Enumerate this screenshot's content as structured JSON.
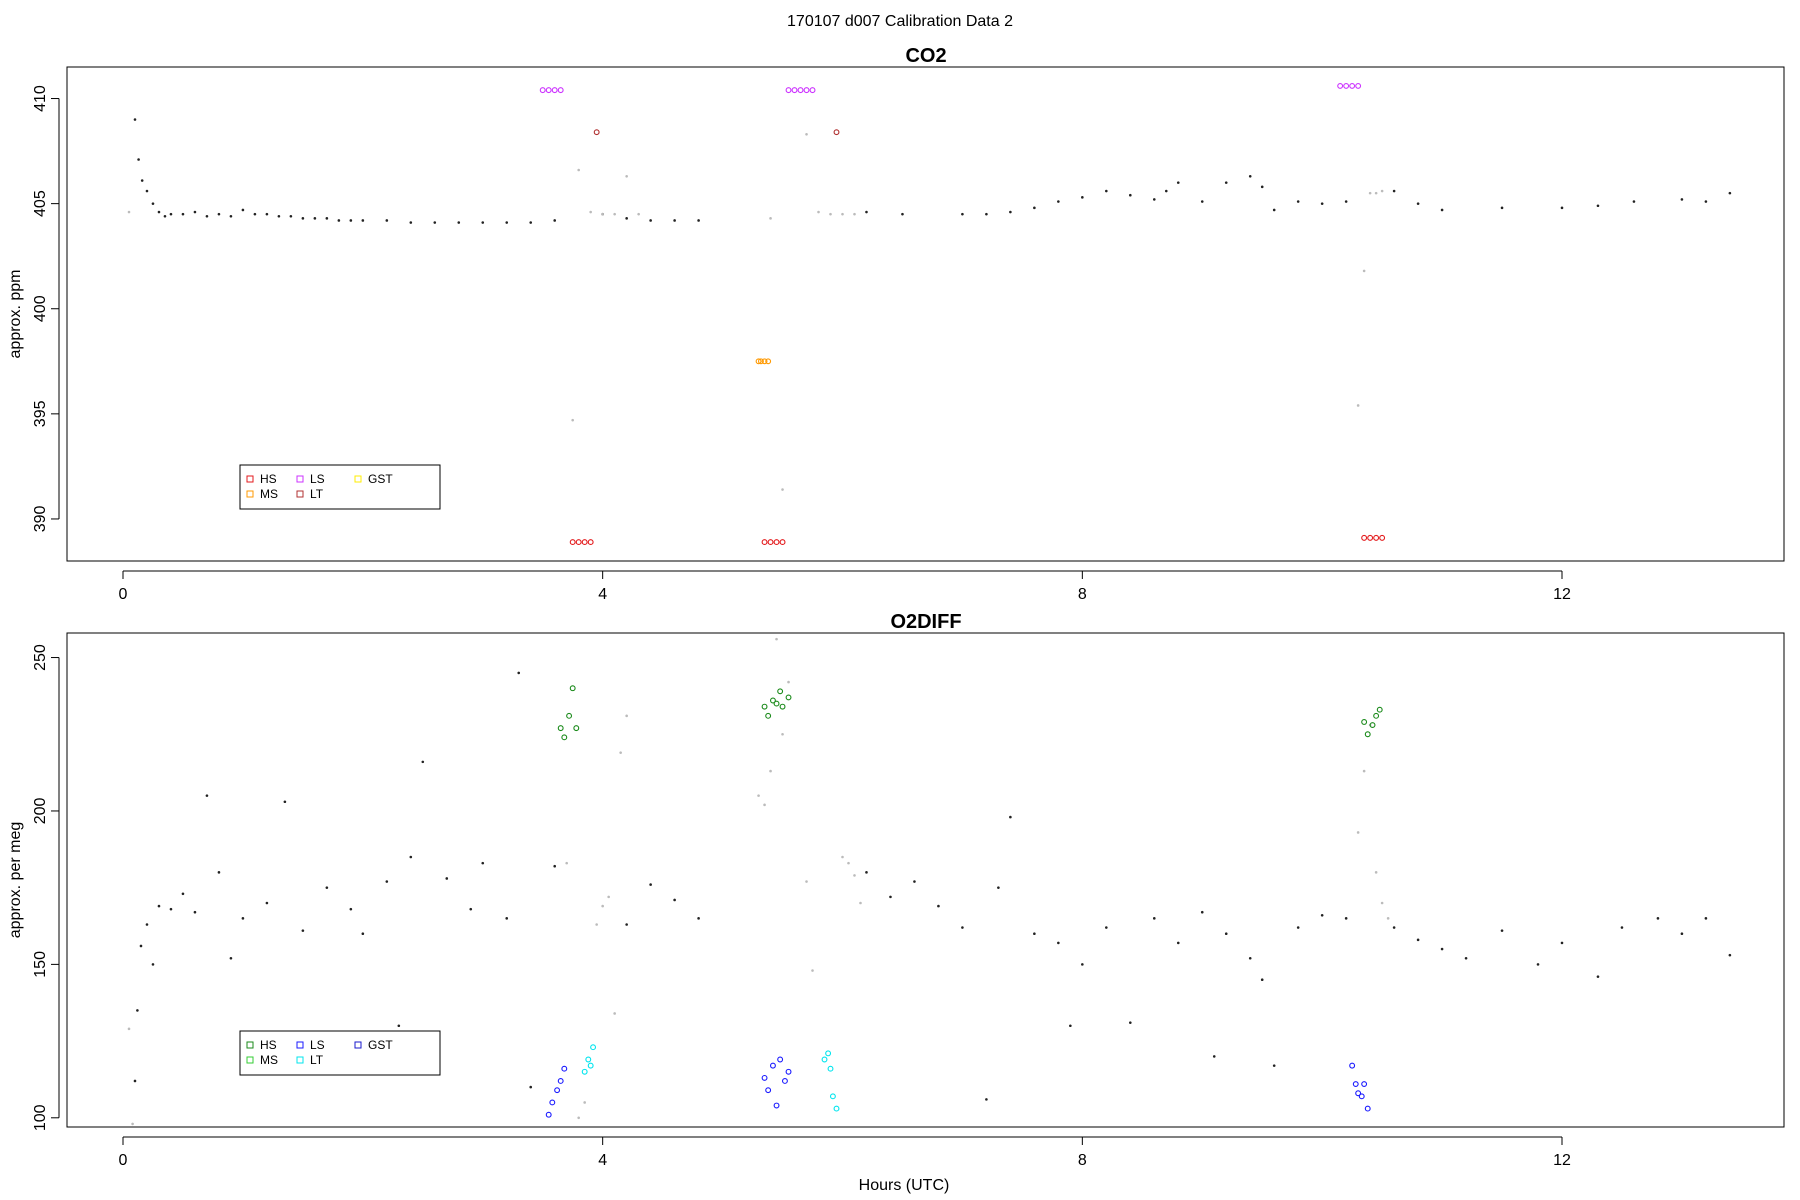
{
  "suptitle": "170107   d007   Calibration Data 2",
  "chart_data": [
    {
      "type": "scatter",
      "title": "CO2",
      "xlabel": "",
      "ylabel": "approx. ppm",
      "xlim": [
        0,
        13.5
      ],
      "ylim": [
        388.0,
        411.5
      ],
      "xticks": [
        0,
        4,
        8,
        12
      ],
      "yticks": [
        390,
        395,
        400,
        405,
        410
      ],
      "legend": [
        {
          "label": "HS",
          "color": "#e31a1c"
        },
        {
          "label": "MS",
          "color": "#ff9900"
        },
        {
          "label": "LS",
          "color": "#cc33ff"
        },
        {
          "label": "LT",
          "color": "#b03030"
        },
        {
          "label": "GST",
          "color": "#ffee00"
        }
      ],
      "series": [
        {
          "role": "ambient",
          "color": "#222222",
          "x": [
            0.1,
            0.13,
            0.16,
            0.2,
            0.25,
            0.3,
            0.35,
            0.4,
            0.5,
            0.6,
            0.7,
            0.8,
            0.9,
            1.0,
            1.1,
            1.2,
            1.3,
            1.4,
            1.5,
            1.6,
            1.7,
            1.8,
            1.9,
            2.0,
            2.2,
            2.4,
            2.6,
            2.8,
            3.0,
            3.2,
            3.4,
            3.6,
            4.0,
            4.2,
            4.4,
            4.6,
            4.8,
            6.2,
            6.5,
            7.0,
            7.2,
            7.4,
            7.6,
            7.8,
            8.0,
            8.2,
            8.4,
            8.6,
            8.7,
            8.8,
            9.0,
            9.2,
            9.4,
            9.5,
            9.6,
            9.8,
            10.0,
            10.2,
            10.6,
            10.8,
            11.0,
            11.5,
            12.0,
            12.3,
            12.6,
            13.0,
            13.2,
            13.4
          ],
          "y": [
            409.0,
            407.1,
            406.1,
            405.6,
            405.0,
            404.6,
            404.4,
            404.5,
            404.5,
            404.6,
            404.4,
            404.5,
            404.4,
            404.7,
            404.5,
            404.5,
            404.4,
            404.4,
            404.3,
            404.3,
            404.3,
            404.2,
            404.2,
            404.2,
            404.2,
            404.1,
            404.1,
            404.1,
            404.1,
            404.1,
            404.1,
            404.2,
            404.5,
            404.3,
            404.2,
            404.2,
            404.2,
            404.6,
            404.5,
            404.5,
            404.5,
            404.6,
            404.8,
            405.1,
            405.3,
            405.6,
            405.4,
            405.2,
            405.6,
            406.0,
            405.1,
            406.0,
            406.3,
            405.8,
            404.7,
            405.1,
            405.0,
            405.1,
            405.6,
            405.0,
            404.7,
            404.8,
            404.8,
            404.9,
            405.1,
            405.2,
            405.1,
            405.5
          ]
        },
        {
          "role": "flush",
          "color": "#bbbbbb",
          "x": [
            0.05,
            3.75,
            3.8,
            3.9,
            4.0,
            4.1,
            4.2,
            4.3,
            5.4,
            5.5,
            5.7,
            5.8,
            5.9,
            6.0,
            6.1,
            10.3,
            10.35,
            10.4,
            10.45,
            10.5
          ],
          "y": [
            404.6,
            394.7,
            406.6,
            404.6,
            404.5,
            404.5,
            406.3,
            404.5,
            404.3,
            391.4,
            408.3,
            404.6,
            404.5,
            404.5,
            404.5,
            395.4,
            401.8,
            405.5,
            405.5,
            405.6
          ]
        },
        {
          "name": "HS",
          "color": "#e31a1c",
          "x": [
            3.75,
            3.8,
            3.85,
            3.9,
            5.35,
            5.4,
            5.45,
            5.5,
            10.35,
            10.4,
            10.45,
            10.5
          ],
          "y": [
            388.9,
            388.9,
            388.9,
            388.9,
            388.9,
            388.9,
            388.9,
            388.9,
            389.1,
            389.1,
            389.1,
            389.1
          ]
        },
        {
          "name": "MS",
          "color": "#ff9900",
          "x": [
            5.3,
            5.32,
            5.35,
            5.38
          ],
          "y": [
            397.5,
            397.5,
            397.5,
            397.5
          ]
        },
        {
          "name": "LS",
          "color": "#cc33ff",
          "x": [
            3.5,
            3.55,
            3.6,
            3.65,
            5.55,
            5.6,
            5.65,
            5.7,
            5.75,
            10.15,
            10.2,
            10.25,
            10.3
          ],
          "y": [
            410.4,
            410.4,
            410.4,
            410.4,
            410.4,
            410.4,
            410.4,
            410.4,
            410.4,
            410.6,
            410.6,
            410.6,
            410.6
          ]
        },
        {
          "name": "LT",
          "color": "#b03030",
          "x": [
            3.95,
            5.95
          ],
          "y": [
            408.4,
            408.4
          ]
        }
      ]
    },
    {
      "type": "scatter",
      "title": "O2DIFF",
      "xlabel": "Hours (UTC)",
      "ylabel": "approx. per meg",
      "xlim": [
        0,
        13.5
      ],
      "ylim": [
        97,
        258
      ],
      "xticks": [
        0,
        4,
        8,
        12
      ],
      "yticks": [
        100,
        150,
        200,
        250
      ],
      "legend": [
        {
          "label": "HS",
          "color": "#1a8a1a"
        },
        {
          "label": "MS",
          "color": "#33cc33"
        },
        {
          "label": "LS",
          "color": "#1a1aff"
        },
        {
          "label": "LT",
          "color": "#00e5ee"
        },
        {
          "label": "GST",
          "color": "#1a1acc"
        }
      ],
      "series": [
        {
          "role": "ambient",
          "color": "#222222",
          "x": [
            0.1,
            0.12,
            0.15,
            0.2,
            0.25,
            0.3,
            0.4,
            0.5,
            0.6,
            0.7,
            0.8,
            0.9,
            1.0,
            1.2,
            1.35,
            1.5,
            1.7,
            1.9,
            2.0,
            2.2,
            2.3,
            2.4,
            2.5,
            2.7,
            2.9,
            3.0,
            3.2,
            3.3,
            3.4,
            3.6,
            4.2,
            4.4,
            4.6,
            4.8,
            6.2,
            6.4,
            6.6,
            6.8,
            7.0,
            7.2,
            7.3,
            7.4,
            7.6,
            7.8,
            7.9,
            8.0,
            8.2,
            8.4,
            8.6,
            8.8,
            9.0,
            9.1,
            9.2,
            9.4,
            9.5,
            9.6,
            9.8,
            10.0,
            10.2,
            10.6,
            10.8,
            11.0,
            11.2,
            11.5,
            11.8,
            12.0,
            12.3,
            12.5,
            12.8,
            13.0,
            13.2,
            13.4
          ],
          "y": [
            112,
            135,
            156,
            163,
            150,
            169,
            168,
            173,
            167,
            205,
            180,
            152,
            165,
            170,
            203,
            161,
            175,
            168,
            160,
            177,
            130,
            185,
            216,
            178,
            168,
            183,
            165,
            245,
            110,
            182,
            163,
            176,
            171,
            165,
            180,
            172,
            177,
            169,
            162,
            106,
            175,
            198,
            160,
            157,
            130,
            150,
            162,
            131,
            165,
            157,
            167,
            120,
            160,
            152,
            145,
            117,
            162,
            166,
            165,
            162,
            158,
            155,
            152,
            161,
            150,
            157,
            146,
            162,
            165,
            160,
            165,
            153
          ]
        },
        {
          "role": "flush",
          "color": "#bbbbbb",
          "x": [
            0.05,
            0.08,
            3.7,
            3.8,
            3.85,
            3.95,
            4.0,
            4.05,
            4.1,
            4.15,
            4.2,
            5.3,
            5.35,
            5.4,
            5.45,
            5.5,
            5.55,
            5.7,
            5.75,
            6.0,
            6.05,
            6.1,
            6.15,
            10.3,
            10.35,
            10.4,
            10.45,
            10.5,
            10.55
          ],
          "y": [
            129,
            98,
            183,
            100,
            105,
            163,
            169,
            172,
            134,
            219,
            231,
            205,
            202,
            213,
            256,
            225,
            242,
            177,
            148,
            185,
            183,
            179,
            170,
            193,
            213,
            228,
            180,
            170,
            165
          ]
        },
        {
          "name": "HS",
          "color": "#1a8a1a",
          "x": [
            3.65,
            3.68,
            3.72,
            3.75,
            3.78,
            5.35,
            5.38,
            5.42,
            5.45,
            5.48,
            5.5,
            5.55,
            10.35,
            10.38,
            10.42,
            10.45,
            10.48
          ],
          "y": [
            227,
            224,
            231,
            240,
            227,
            234,
            231,
            236,
            235,
            239,
            234,
            237,
            229,
            225,
            228,
            231,
            233
          ]
        },
        {
          "name": "LS",
          "color": "#1a1aff",
          "x": [
            3.55,
            3.58,
            3.62,
            3.65,
            3.68,
            5.35,
            5.38,
            5.42,
            5.45,
            5.48,
            5.52,
            5.55,
            10.25,
            10.28,
            10.3,
            10.33,
            10.35,
            10.38
          ],
          "y": [
            101,
            105,
            109,
            112,
            116,
            113,
            109,
            117,
            104,
            119,
            112,
            115,
            117,
            111,
            108,
            107,
            111,
            103
          ]
        },
        {
          "name": "LT",
          "color": "#00e5ee",
          "x": [
            3.85,
            3.88,
            3.9,
            3.92,
            5.85,
            5.88,
            5.9,
            5.92,
            5.95
          ],
          "y": [
            115,
            119,
            117,
            123,
            119,
            121,
            116,
            107,
            103
          ]
        }
      ]
    }
  ]
}
